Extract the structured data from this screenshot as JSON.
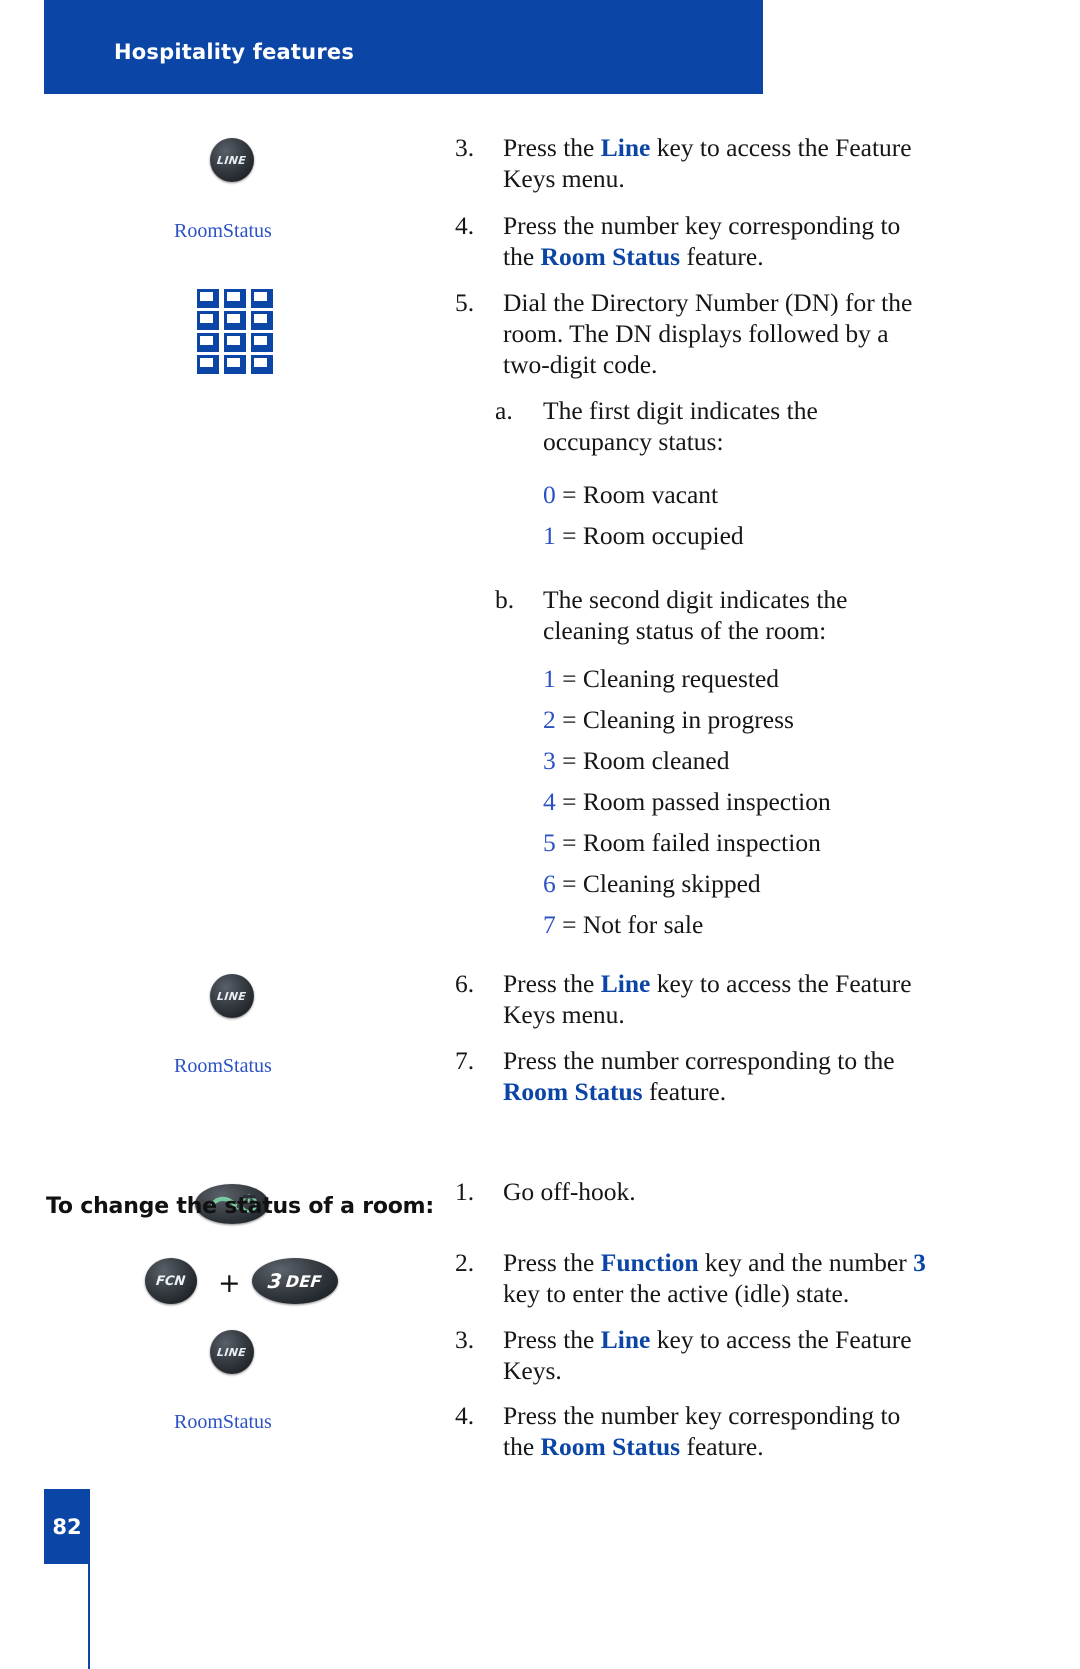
{
  "header": {
    "title": "Hospitality features"
  },
  "icons": {
    "line_key_label": "LINE",
    "room_status_label": "RoomStatus",
    "fcn_key_label": "FCN",
    "def_key_number": "3",
    "def_key_letters": "DEF",
    "plus_separator": "+"
  },
  "colors": {
    "brand_blue": "#0B45A6",
    "link_blue": "#2B51C4",
    "key_dark": "#24282d",
    "handset_green": "#79c9a0"
  },
  "steps_top": [
    {
      "num": "3.",
      "parts": [
        {
          "t": "Press the ",
          "b": false
        },
        {
          "t": "Line",
          "b": true
        },
        {
          "t": " key to access the Feature Keys menu.",
          "b": false
        }
      ]
    },
    {
      "num": "4.",
      "parts": [
        {
          "t": "Press the number key corresponding to the ",
          "b": false
        },
        {
          "t": "Room Status",
          "b": true
        },
        {
          "t": " feature.",
          "b": false
        }
      ]
    },
    {
      "num": "5.",
      "parts": [
        {
          "t": "Dial the Directory Number (DN) for the room. The DN displays followed by a two-digit code.",
          "b": false
        }
      ]
    }
  ],
  "substep_a": {
    "num": "a.",
    "text": "The first digit indicates the occupancy status:"
  },
  "occupancy_codes": [
    {
      "digit": "0",
      "label": "= Room vacant"
    },
    {
      "digit": "1",
      "label": "= Room occupied"
    }
  ],
  "substep_b": {
    "num": "b.",
    "text": "The second digit indicates the cleaning status of the room:"
  },
  "cleaning_codes": [
    {
      "digit": "1",
      "label": "= Cleaning requested"
    },
    {
      "digit": "2",
      "label": "= Cleaning in progress"
    },
    {
      "digit": "3",
      "label": "= Room cleaned"
    },
    {
      "digit": "4",
      "label": "= Room passed inspection"
    },
    {
      "digit": "5",
      "label": "= Room failed inspection"
    },
    {
      "digit": "6",
      "label": "= Cleaning skipped"
    },
    {
      "digit": "7",
      "label": "= Not for sale"
    }
  ],
  "steps_mid": [
    {
      "num": "6.",
      "parts": [
        {
          "t": "Press the ",
          "b": false
        },
        {
          "t": "Line",
          "b": true
        },
        {
          "t": " key to access the Feature Keys menu.",
          "b": false
        }
      ]
    },
    {
      "num": "7.",
      "parts": [
        {
          "t": "Press the number corresponding to the ",
          "b": false
        },
        {
          "t": "Room Status",
          "b": true
        },
        {
          "t": " feature.",
          "b": false
        }
      ]
    }
  ],
  "section": {
    "heading": "To change the status of a room:"
  },
  "steps_bottom": [
    {
      "num": "1.",
      "parts": [
        {
          "t": "Go off-hook.",
          "b": false
        }
      ]
    },
    {
      "num": "2.",
      "parts": [
        {
          "t": "Press the ",
          "b": false
        },
        {
          "t": "Function",
          "b": true
        },
        {
          "t": " key and the number ",
          "b": false
        },
        {
          "t": "3",
          "b": true
        },
        {
          "t": " key to enter the active (idle) state.",
          "b": false
        }
      ]
    },
    {
      "num": "3.",
      "parts": [
        {
          "t": "Press the ",
          "b": false
        },
        {
          "t": "Line",
          "b": true
        },
        {
          "t": " key to access the Feature Keys.",
          "b": false
        }
      ]
    },
    {
      "num": "4.",
      "parts": [
        {
          "t": "Press the number key corresponding to the ",
          "b": false
        },
        {
          "t": "Room Status",
          "b": true
        },
        {
          "t": " feature.",
          "b": false
        }
      ]
    }
  ],
  "footer": {
    "page_number": "82"
  }
}
